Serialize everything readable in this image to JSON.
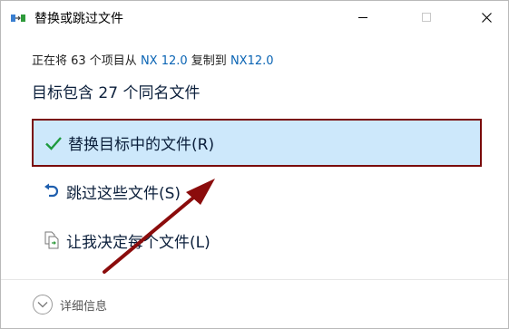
{
  "window": {
    "title": "替换或跳过文件",
    "icon": "file-move-icon"
  },
  "controls": {
    "minimize_icon": "minimize-icon",
    "maximize_icon": "maximize-icon",
    "close_icon": "close-icon"
  },
  "progress": {
    "prefix": "正在将 63 个项目从 ",
    "source": "NX 12.0",
    "middle": " 复制到 ",
    "destination": "NX12.0"
  },
  "conflict": {
    "headline": "目标包含 27 个同名文件"
  },
  "options": {
    "replace": {
      "label": "替换目标中的文件(R)",
      "icon": "checkmark-icon"
    },
    "skip": {
      "label": "跳过这些文件(S)",
      "icon": "undo-arrow-icon"
    },
    "decide": {
      "label": "让我决定每个文件(L)",
      "icon": "file-compare-icon"
    }
  },
  "footer": {
    "details_label": "详细信息",
    "details_icon": "chevron-down-icon"
  },
  "colors": {
    "selected_background": "#cde8fb",
    "highlight_border": "#7a0b0b",
    "link": "#0a64b4",
    "annotation_arrow": "#8b0c0c"
  }
}
